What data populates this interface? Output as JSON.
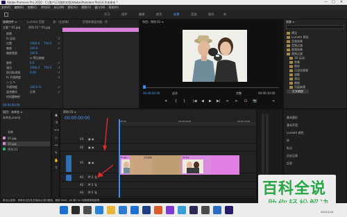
{
  "window": {
    "title": "Adobe Premiere Pro 2020 - C:\\用户\\13\\我的文档\\Adobe\\Premiere Pro\\14.0\\未命名 *",
    "minimize": "—",
    "maximize": "□",
    "close": "✕"
  },
  "menu": [
    "文件(F)",
    "编辑(E)",
    "剪辑(C)",
    "序列(S)",
    "标记(M)",
    "图形(G)",
    "视图(V)",
    "窗口(W)",
    "帮助(H)"
  ],
  "workspace_tabs": [
    {
      "label": "学习",
      "active": false
    },
    {
      "label": "组件",
      "active": false
    },
    {
      "label": "编辑",
      "active": false
    },
    {
      "label": "颜色",
      "active": false
    },
    {
      "label": "效果",
      "active": true
    },
    {
      "label": "音频",
      "active": false
    },
    {
      "label": "图形",
      "active": false
    },
    {
      "label": "库",
      "active": false
    }
  ],
  "effect_controls": {
    "tabs": [
      "效果控件 ≡",
      "Lumetri 范围",
      "源：(无剪辑)",
      "音频剪辑混合器：序"
    ],
    "source_line": "主要 * 01.jpg",
    "sequence_line": "序列 01 * 01.jpg",
    "rows": [
      {
        "label": "视频",
        "v1": "",
        "v2": ""
      },
      {
        "label": "fx 运动",
        "v1": "",
        "v2": ""
      },
      {
        "label": "位置",
        "v1": "1000.0",
        "v2": "750.0"
      },
      {
        "label": "缩放",
        "v1": "100.0",
        "v2": ""
      },
      {
        "label": "缩放宽度",
        "v1": "100.0",
        "v2": ""
      },
      {
        "label": "",
        "v1": "☑ 等比缩放",
        "v2": ""
      },
      {
        "label": "旋转",
        "v1": "0.0",
        "v2": ""
      },
      {
        "label": "锚点",
        "v1": "1000.0",
        "v2": "750.0"
      },
      {
        "label": "防闪烁滤镜",
        "v1": "0.00",
        "v2": ""
      },
      {
        "label": "fx 不透明度",
        "v1": "",
        "v2": ""
      },
      {
        "label": "○ □ ✎",
        "v1": "",
        "v2": ""
      },
      {
        "label": "不透明度",
        "v1": "100.0 %",
        "v2": ""
      },
      {
        "label": "混合模式",
        "v1": "正常",
        "v2": ""
      },
      {
        "label": "时间重映射",
        "v1": "",
        "v2": ""
      }
    ],
    "timecode": "00:00:00:00"
  },
  "program_monitor": {
    "tab": "节目：序列 01 ≡",
    "timecode_left": "00:00:00:00",
    "fit_label": "适合",
    "quality_label": "完整",
    "timecode_right": "00:00:10:00",
    "controls": [
      "▾",
      "{",
      "}",
      "|◀",
      "◀",
      "▶",
      "▶|",
      "⇥",
      "⇤",
      "⊡",
      "📷",
      "+"
    ]
  },
  "project": {
    "tab": "效果 ≡",
    "search_placeholder": "",
    "items": [
      {
        "label": "预设",
        "indent": 0
      },
      {
        "label": "Lumetri 预设",
        "indent": 0
      },
      {
        "label": "音频效果",
        "indent": 0
      },
      {
        "label": "音频过渡",
        "indent": 0
      },
      {
        "label": "视频效果",
        "indent": 0
      },
      {
        "label": "视频过渡",
        "indent": 0
      },
      {
        "label": "3D 运动",
        "indent": 1
      },
      {
        "label": "划像",
        "indent": 1
      },
      {
        "label": "擦除",
        "indent": 1
      },
      {
        "label": "沉浸式视频",
        "indent": 1
      },
      {
        "label": "溶解",
        "indent": 1
      },
      {
        "label": "滑动",
        "indent": 1
      },
      {
        "label": "缩放",
        "indent": 1
      },
      {
        "label": "页面剥落",
        "indent": 1
      },
      {
        "label": "交叉缩放",
        "indent": 2
      }
    ]
  },
  "effects_panel": {
    "items": [
      "基本图形",
      "基本声音",
      "Lumetri 颜色",
      "库",
      "标记",
      "历史记录",
      "信息"
    ]
  },
  "bin": {
    "tab": "项目：未命名 ≡",
    "file": "未命名.prproj",
    "header": "名称",
    "items": [
      {
        "name": "01.jpg",
        "color": "#d38ad6"
      },
      {
        "name": "02.jpg",
        "color": "#d38ad6"
      },
      {
        "name": "序列 01",
        "color": "#3aa85d"
      }
    ]
  },
  "timeline": {
    "tab": "序列 01 ≡",
    "timecode": "00:00:00:00",
    "ruler_labels": [
      "00:00",
      "00:00:05:00",
      "00:00:10:00"
    ],
    "tracks": [
      {
        "name": "V3",
        "type": "video"
      },
      {
        "name": "V2",
        "type": "video"
      },
      {
        "name": "V1",
        "type": "video"
      },
      {
        "name": "A1",
        "type": "audio"
      },
      {
        "name": "A2",
        "type": "audio"
      },
      {
        "name": "A3",
        "type": "audio"
      },
      {
        "name": "主声道",
        "type": "master",
        "value": "0.0"
      }
    ],
    "clip_labels": [
      "01.jpg",
      "交叉缩放",
      "02.jpg"
    ]
  },
  "status_bar": "单击以选择，或单击空白处并拖动以进行框选。使用 Shift、Alt 和 Ctrl 可获得其他选项。",
  "watermark": {
    "title": "百科全说",
    "subtitle": "助你轻松解决",
    "color": "#26a745"
  },
  "taskbar": {
    "date": "2022/1/14",
    "time": "21:59"
  }
}
